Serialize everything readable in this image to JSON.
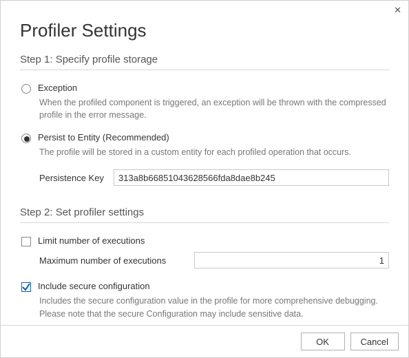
{
  "title": "Profiler Settings",
  "close_glyph": "✕",
  "step1": {
    "heading": "Step 1: Specify profile storage",
    "option_exception": {
      "label": "Exception",
      "desc": "When the profiled component is triggered, an exception will be thrown with the compressed profile in the error message."
    },
    "option_persist": {
      "label": "Persist to Entity (Recommended)",
      "desc": "The profile will be stored in a custom entity for each profiled operation that occurs."
    },
    "persistence_key_label": "Persistence Key",
    "persistence_key_value": "313a8b66851043628566fda8dae8b245"
  },
  "step2": {
    "heading": "Step 2: Set profiler settings",
    "limit_label": "Limit number of executions",
    "max_label": "Maximum number of executions",
    "max_value": "1",
    "include_secure_label": "Include secure configuration",
    "include_secure_desc": "Includes the secure configuration value in the profile for more comprehensive debugging. Please note that the secure Configuration may include sensitive data."
  },
  "buttons": {
    "ok": "OK",
    "cancel": "Cancel"
  }
}
